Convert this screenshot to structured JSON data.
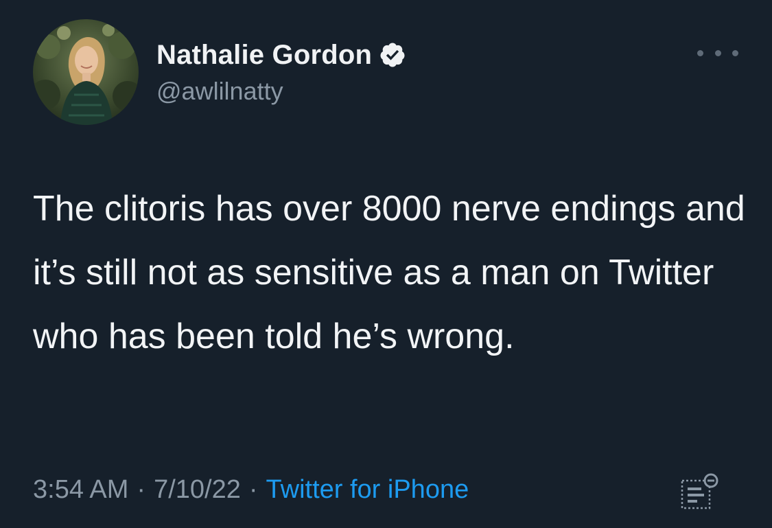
{
  "author": {
    "display_name": "Nathalie Gordon",
    "handle": "@awlilnatty",
    "verified": true
  },
  "tweet": {
    "text": "The clitoris has over 8000 nerve endings and it’s still not as sensitive as a man on Twitter who has been told he’s wrong.",
    "time": "3:54 AM",
    "date": "7/10/22",
    "separator": "·",
    "source": "Twitter for iPhone"
  },
  "icons": {
    "verified": "verified-badge-icon",
    "more": "more-options-icon",
    "analytics": "tweet-analytics-icon"
  },
  "colors": {
    "background": "#16202b",
    "text": "#f2f4f6",
    "secondary_text": "#8b98a5",
    "link": "#1d9bf0"
  }
}
